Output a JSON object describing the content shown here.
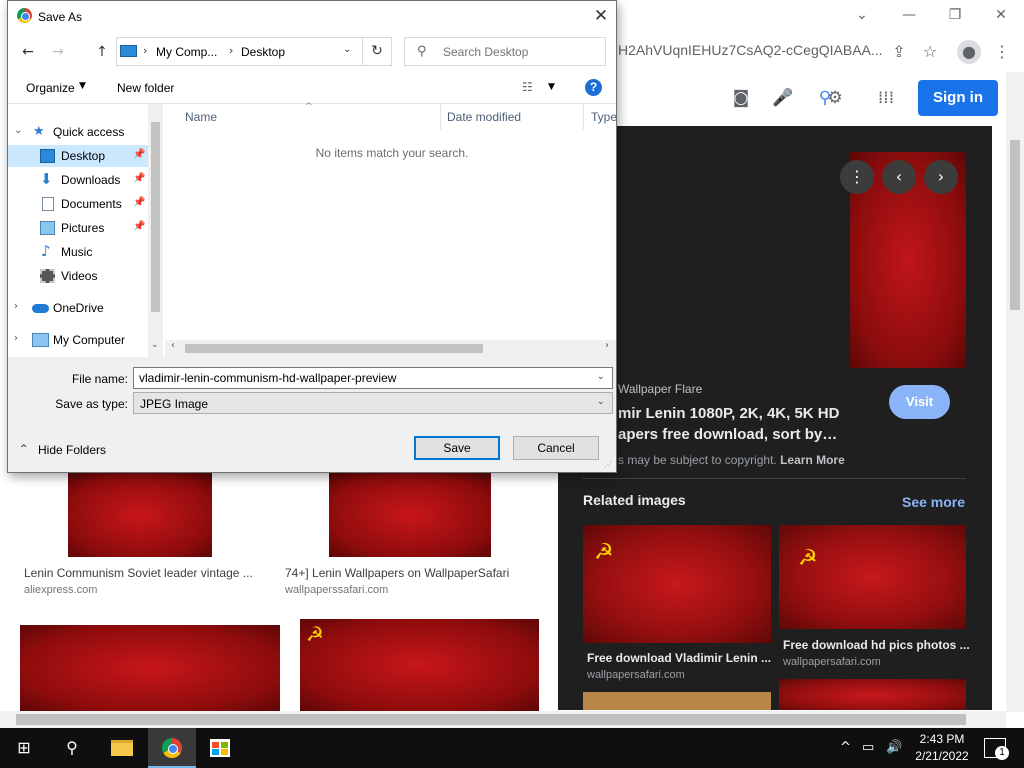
{
  "browser": {
    "url_partial": "H2AhVUqnIEHUz7CsAQ2-cCegQIABAA...",
    "signin_label": "Sign in",
    "icons": [
      "share-icon",
      "star-icon",
      "profile-icon",
      "menu-icon"
    ]
  },
  "preview_panel": {
    "source": "Wallpaper Flare",
    "title_line1": "mir Lenin 1080P, 2K, 4K, 5K HD",
    "title_line2": "apers free download, sort by…",
    "visit_label": "Visit",
    "copyright_text": "s may be subject to copyright.",
    "learn_more": "Learn More",
    "related_title": "Related images",
    "see_more": "See more",
    "related": [
      {
        "caption": "Free download Vladimir Lenin ...",
        "source": "wallpapersafari.com"
      },
      {
        "caption": "Free download hd pics photos ...",
        "source": "wallpapersafari.com"
      }
    ]
  },
  "results": [
    {
      "title": "Lenin Communism Soviet leader vintage ...",
      "source": "aliexpress.com"
    },
    {
      "title": "74+] Lenin Wallpapers on WallpaperSafari",
      "source": "wallpaperssafari.com"
    }
  ],
  "dialog": {
    "title": "Save As",
    "breadcrumb": [
      "My Comp...",
      "Desktop"
    ],
    "search_placeholder": "Search Desktop",
    "organize_label": "Organize",
    "new_folder_label": "New folder",
    "nav_items": [
      {
        "label": "Quick access",
        "icon": "star-icon"
      },
      {
        "label": "Desktop",
        "icon": "desktop-icon",
        "selected": true
      },
      {
        "label": "Downloads",
        "icon": "download-icon"
      },
      {
        "label": "Documents",
        "icon": "document-icon"
      },
      {
        "label": "Pictures",
        "icon": "pictures-icon"
      },
      {
        "label": "Music",
        "icon": "music-icon"
      },
      {
        "label": "Videos",
        "icon": "videos-icon"
      },
      {
        "label": "OneDrive",
        "icon": "cloud-icon"
      },
      {
        "label": "My Computer",
        "icon": "computer-icon"
      }
    ],
    "columns": [
      "Name",
      "Date modified",
      "Type"
    ],
    "empty_message": "No items match your search.",
    "file_name_label": "File name:",
    "file_name_value": "vladimir-lenin-communism-hd-wallpaper-preview",
    "save_type_label": "Save as type:",
    "save_type_value": "JPEG Image",
    "hide_folders_label": "Hide Folders",
    "save_label": "Save",
    "cancel_label": "Cancel"
  },
  "taskbar": {
    "time": "2:43 PM",
    "date": "2/21/2022",
    "notification_count": "1"
  }
}
